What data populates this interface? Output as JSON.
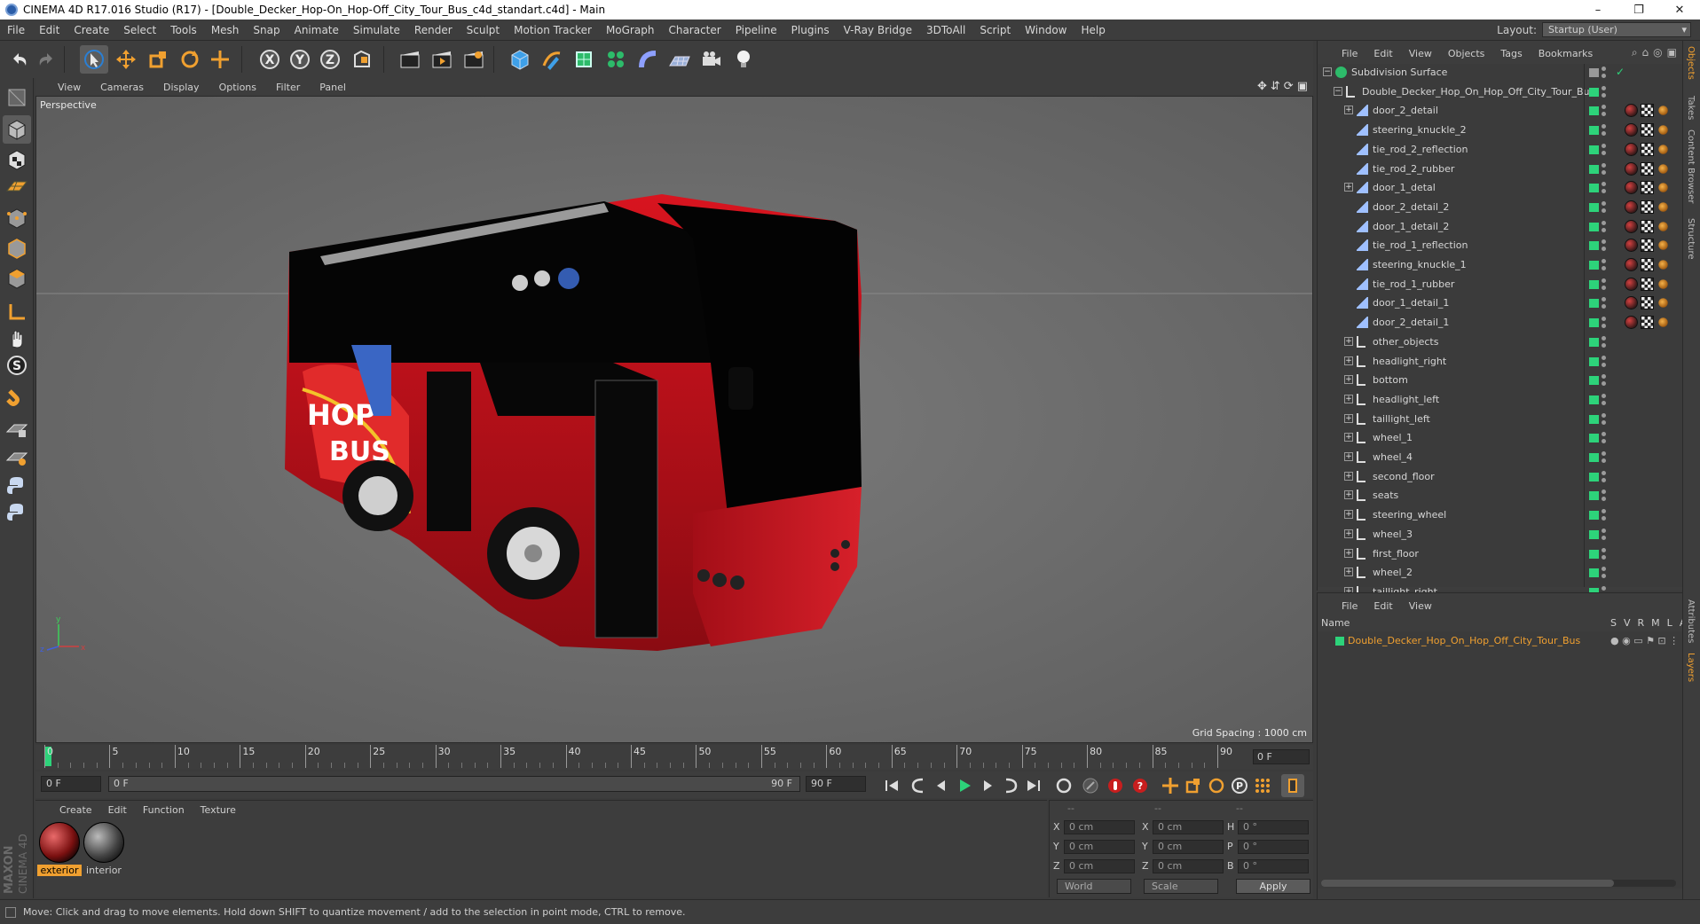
{
  "window": {
    "title": "CINEMA 4D R17.016 Studio (R17) - [Double_Decker_Hop-On_Hop-Off_City_Tour_Bus_c4d_standart.c4d] - Main",
    "min": "–",
    "max": "❐",
    "close": "✕"
  },
  "menu": [
    "File",
    "Edit",
    "Create",
    "Select",
    "Tools",
    "Mesh",
    "Snap",
    "Animate",
    "Simulate",
    "Render",
    "Sculpt",
    "Motion Tracker",
    "MoGraph",
    "Character",
    "Pipeline",
    "Plugins",
    "V-Ray Bridge",
    "3DToAll",
    "Script",
    "Window",
    "Help"
  ],
  "layout": {
    "label": "Layout:",
    "value": "Startup (User)"
  },
  "viewport_menu": [
    "View",
    "Cameras",
    "Display",
    "Options",
    "Filter",
    "Panel"
  ],
  "viewport": {
    "label": "Perspective",
    "grid_spacing": "Grid Spacing : 1000 cm"
  },
  "timeline": {
    "ticks": [
      "0",
      "5",
      "10",
      "15",
      "20",
      "25",
      "30",
      "35",
      "40",
      "45",
      "50",
      "55",
      "60",
      "65",
      "70",
      "75",
      "80",
      "85",
      "90"
    ],
    "current_frame": "0 F"
  },
  "transport": {
    "start": "0 F",
    "range_start": "0 F",
    "range_end": "90 F",
    "end": "90 F"
  },
  "material_menu": [
    "Create",
    "Edit",
    "Function",
    "Texture"
  ],
  "materials": [
    {
      "name": "exterior"
    },
    {
      "name": "interior"
    }
  ],
  "coords": {
    "header": [
      "--",
      "--",
      "--"
    ],
    "rows": [
      {
        "a": "X",
        "v1": "0 cm",
        "b": "X",
        "v2": "0 cm",
        "c": "H",
        "v3": "0 °"
      },
      {
        "a": "Y",
        "v1": "0 cm",
        "b": "Y",
        "v2": "0 cm",
        "c": "P",
        "v3": "0 °"
      },
      {
        "a": "Z",
        "v1": "0 cm",
        "b": "Z",
        "v2": "0 cm",
        "c": "B",
        "v3": "0 °"
      }
    ],
    "world": "World",
    "scale": "Scale",
    "apply": "Apply"
  },
  "status": "Move: Click and drag to move elements. Hold down SHIFT to quantize movement / add to the selection in point mode, CTRL to remove.",
  "object_menu": [
    "File",
    "Edit",
    "View",
    "Objects",
    "Tags",
    "Bookmarks"
  ],
  "objects": [
    {
      "name": "Subdivision Surface",
      "depth": 0,
      "type": "sub",
      "expand": "−"
    },
    {
      "name": "Double_Decker_Hop_On_Hop_Off_City_Tour_Bus",
      "depth": 1,
      "type": "null",
      "expand": "−"
    },
    {
      "name": "door_2_detail",
      "depth": 2,
      "type": "mesh",
      "expand": "+",
      "tags": true
    },
    {
      "name": "steering_knuckle_2",
      "depth": 2,
      "type": "mesh",
      "tags": true
    },
    {
      "name": "tie_rod_2_reflection",
      "depth": 2,
      "type": "mesh",
      "tags": true
    },
    {
      "name": "tie_rod_2_rubber",
      "depth": 2,
      "type": "mesh",
      "tags": true
    },
    {
      "name": "door_1_detal",
      "depth": 2,
      "type": "mesh",
      "expand": "+",
      "tags": true
    },
    {
      "name": "door_2_detail_2",
      "depth": 2,
      "type": "mesh",
      "tags": true
    },
    {
      "name": "door_1_detail_2",
      "depth": 2,
      "type": "mesh",
      "tags": true
    },
    {
      "name": "tie_rod_1_reflection",
      "depth": 2,
      "type": "mesh",
      "tags": true
    },
    {
      "name": "steering_knuckle_1",
      "depth": 2,
      "type": "mesh",
      "tags": true
    },
    {
      "name": "tie_rod_1_rubber",
      "depth": 2,
      "type": "mesh",
      "tags": true
    },
    {
      "name": "door_1_detail_1",
      "depth": 2,
      "type": "mesh",
      "tags": true
    },
    {
      "name": "door_2_detail_1",
      "depth": 2,
      "type": "mesh",
      "tags": true
    },
    {
      "name": "other_objects",
      "depth": 2,
      "type": "null",
      "expand": "+"
    },
    {
      "name": "headlight_right",
      "depth": 2,
      "type": "null",
      "expand": "+"
    },
    {
      "name": "bottom",
      "depth": 2,
      "type": "null",
      "expand": "+"
    },
    {
      "name": "headlight_left",
      "depth": 2,
      "type": "null",
      "expand": "+"
    },
    {
      "name": "taillight_left",
      "depth": 2,
      "type": "null",
      "expand": "+"
    },
    {
      "name": "wheel_1",
      "depth": 2,
      "type": "null",
      "expand": "+"
    },
    {
      "name": "wheel_4",
      "depth": 2,
      "type": "null",
      "expand": "+"
    },
    {
      "name": "second_floor",
      "depth": 2,
      "type": "null",
      "expand": "+"
    },
    {
      "name": "seats",
      "depth": 2,
      "type": "null",
      "expand": "+"
    },
    {
      "name": "steering_wheel",
      "depth": 2,
      "type": "null",
      "expand": "+"
    },
    {
      "name": "wheel_3",
      "depth": 2,
      "type": "null",
      "expand": "+"
    },
    {
      "name": "first_floor",
      "depth": 2,
      "type": "null",
      "expand": "+"
    },
    {
      "name": "wheel_2",
      "depth": 2,
      "type": "null",
      "expand": "+"
    },
    {
      "name": "taillight_right",
      "depth": 2,
      "type": "null",
      "expand": "+"
    }
  ],
  "layer_menu": [
    "File",
    "Edit",
    "View"
  ],
  "layer_cols": {
    "name": "Name",
    "flags": [
      "S",
      "V",
      "R",
      "M",
      "L",
      "A"
    ]
  },
  "layers": [
    {
      "name": "Double_Decker_Hop_On_Hop_Off_City_Tour_Bus",
      "color": "#2dd37a"
    }
  ],
  "side_tabs": [
    "Objects",
    "Takes",
    "Content Browser",
    "Structure",
    "Attributes",
    "Layers"
  ],
  "colors": {
    "accent": "#2dd37a",
    "orange": "#f0a030",
    "bus_red": "#c8121e"
  }
}
